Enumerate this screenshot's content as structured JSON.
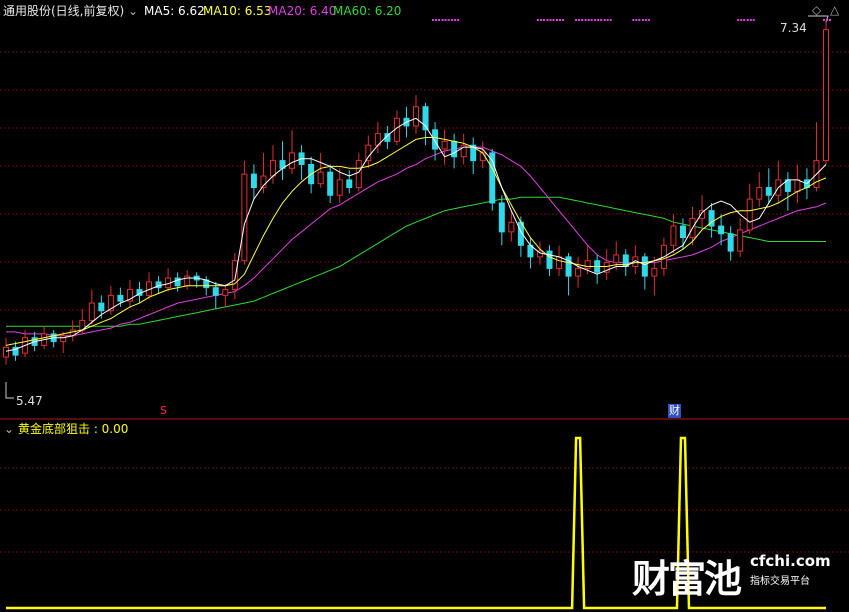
{
  "header": {
    "stock": "通用股份(日线,前复权)",
    "ma5": "MA5: 6.62",
    "ma10": "MA10: 6.53",
    "ma20": "MA20: 6.40",
    "ma60": "MA60: 6.20",
    "indicator": "黄金底部狙击 : 0.00"
  },
  "colors": {
    "up": "#e03030",
    "down": "#30d8e8",
    "ma5": "#ffffff",
    "ma10": "#ffff40",
    "ma20": "#e040e0",
    "ma60": "#30d830",
    "signal": "#ffff00",
    "border": "#b01818"
  },
  "markers": {
    "max_label": "7.34",
    "min_label": "5.47",
    "s_label": "S",
    "cai_label": "财"
  },
  "logo": {
    "cn": "财富池",
    "en": "cfchi.com",
    "sub": "指标交易平台"
  },
  "chart_data": {
    "type": "candlestick",
    "price_range": [
      5.47,
      7.34
    ],
    "ma5": [
      5.63,
      5.64,
      5.66,
      5.68,
      5.69,
      5.7,
      5.7,
      5.71,
      5.74,
      5.78,
      5.82,
      5.85,
      5.88,
      5.9,
      5.93,
      5.95,
      5.97,
      5.98,
      6.0,
      6.01,
      6.01,
      6.0,
      5.98,
      5.97,
      6.0,
      6.29,
      6.42,
      6.49,
      6.54,
      6.58,
      6.61,
      6.63,
      6.63,
      6.61,
      6.59,
      6.56,
      6.54,
      6.56,
      6.64,
      6.7,
      6.75,
      6.79,
      6.82,
      6.84,
      6.8,
      6.72,
      6.64,
      6.66,
      6.69,
      6.69,
      6.68,
      6.62,
      6.48,
      6.36,
      6.25,
      6.18,
      6.14,
      6.13,
      6.12,
      6.1,
      6.07,
      6.05,
      6.03,
      6.05,
      6.07,
      6.07,
      6.1,
      6.08,
      6.1,
      6.12,
      6.15,
      6.18,
      6.27,
      6.35,
      6.39,
      6.41,
      6.39,
      6.34,
      6.3,
      6.32,
      6.4,
      6.48,
      6.52,
      6.52,
      6.5,
      6.55,
      6.6
    ],
    "ma10": [
      5.66,
      5.67,
      5.68,
      5.69,
      5.7,
      5.71,
      5.72,
      5.73,
      5.74,
      5.76,
      5.78,
      5.8,
      5.83,
      5.86,
      5.88,
      5.91,
      5.93,
      5.95,
      5.96,
      5.97,
      5.97,
      5.97,
      5.97,
      5.97,
      5.98,
      6.03,
      6.13,
      6.23,
      6.32,
      6.4,
      6.46,
      6.51,
      6.55,
      6.58,
      6.59,
      6.59,
      6.58,
      6.58,
      6.59,
      6.61,
      6.64,
      6.67,
      6.7,
      6.73,
      6.74,
      6.74,
      6.73,
      6.72,
      6.71,
      6.69,
      6.66,
      6.58,
      6.48,
      6.39,
      6.3,
      6.22,
      6.16,
      6.12,
      6.1,
      6.09,
      6.08,
      6.07,
      6.07,
      6.07,
      6.08,
      6.08,
      6.09,
      6.09,
      6.1,
      6.11,
      6.13,
      6.16,
      6.2,
      6.26,
      6.3,
      6.33,
      6.35,
      6.36,
      6.36,
      6.37,
      6.38,
      6.4,
      6.43,
      6.46,
      6.48,
      6.51,
      6.53
    ],
    "ma20": [
      5.73,
      5.73,
      5.72,
      5.72,
      5.72,
      5.71,
      5.71,
      5.71,
      5.72,
      5.73,
      5.74,
      5.75,
      5.77,
      5.78,
      5.8,
      5.82,
      5.84,
      5.86,
      5.88,
      5.89,
      5.9,
      5.91,
      5.92,
      5.93,
      5.94,
      5.97,
      6.01,
      6.06,
      6.11,
      6.16,
      6.21,
      6.25,
      6.29,
      6.33,
      6.37,
      6.39,
      6.42,
      6.45,
      6.48,
      6.51,
      6.53,
      6.55,
      6.58,
      6.6,
      6.63,
      6.65,
      6.67,
      6.68,
      6.69,
      6.69,
      6.69,
      6.67,
      6.65,
      6.62,
      6.59,
      6.54,
      6.48,
      6.42,
      6.36,
      6.3,
      6.24,
      6.18,
      6.13,
      6.1,
      6.09,
      6.09,
      6.09,
      6.09,
      6.09,
      6.1,
      6.11,
      6.12,
      6.13,
      6.15,
      6.17,
      6.2,
      6.22,
      6.24,
      6.26,
      6.28,
      6.3,
      6.32,
      6.34,
      6.36,
      6.37,
      6.38,
      6.4
    ],
    "ma60": [
      5.76,
      5.76,
      5.76,
      5.76,
      5.76,
      5.76,
      5.76,
      5.76,
      5.76,
      5.76,
      5.76,
      5.76,
      5.76,
      5.77,
      5.77,
      5.78,
      5.79,
      5.8,
      5.81,
      5.82,
      5.83,
      5.84,
      5.85,
      5.86,
      5.87,
      5.88,
      5.89,
      5.91,
      5.93,
      5.95,
      5.97,
      5.99,
      6.01,
      6.03,
      6.05,
      6.07,
      6.1,
      6.13,
      6.16,
      6.19,
      6.22,
      6.25,
      6.28,
      6.3,
      6.32,
      6.34,
      6.36,
      6.37,
      6.38,
      6.39,
      6.4,
      6.41,
      6.42,
      6.42,
      6.43,
      6.43,
      6.43,
      6.43,
      6.43,
      6.42,
      6.41,
      6.4,
      6.39,
      6.38,
      6.37,
      6.36,
      6.35,
      6.34,
      6.33,
      6.32,
      6.3,
      6.29,
      6.28,
      6.27,
      6.26,
      6.25,
      6.24,
      6.23,
      6.22,
      6.21,
      6.2,
      6.2,
      6.2,
      6.2,
      6.2,
      6.2,
      6.2
    ],
    "candles": [
      {
        "o": 5.6,
        "c": 5.65,
        "h": 5.7,
        "l": 5.56
      },
      {
        "o": 5.65,
        "c": 5.61,
        "h": 5.68,
        "l": 5.58
      },
      {
        "o": 5.62,
        "c": 5.7,
        "h": 5.74,
        "l": 5.6
      },
      {
        "o": 5.7,
        "c": 5.66,
        "h": 5.73,
        "l": 5.63
      },
      {
        "o": 5.66,
        "c": 5.72,
        "h": 5.76,
        "l": 5.64
      },
      {
        "o": 5.72,
        "c": 5.68,
        "h": 5.74,
        "l": 5.65
      },
      {
        "o": 5.68,
        "c": 5.71,
        "h": 5.73,
        "l": 5.62
      },
      {
        "o": 5.71,
        "c": 5.74,
        "h": 5.79,
        "l": 5.68
      },
      {
        "o": 5.74,
        "c": 5.79,
        "h": 5.85,
        "l": 5.72
      },
      {
        "o": 5.79,
        "c": 5.88,
        "h": 5.95,
        "l": 5.77
      },
      {
        "o": 5.88,
        "c": 5.84,
        "h": 5.92,
        "l": 5.8
      },
      {
        "o": 5.84,
        "c": 5.92,
        "h": 5.97,
        "l": 5.82
      },
      {
        "o": 5.92,
        "c": 5.89,
        "h": 5.96,
        "l": 5.86
      },
      {
        "o": 5.89,
        "c": 5.95,
        "h": 6.0,
        "l": 5.86
      },
      {
        "o": 5.95,
        "c": 5.92,
        "h": 5.99,
        "l": 5.88
      },
      {
        "o": 5.92,
        "c": 5.99,
        "h": 6.04,
        "l": 5.9
      },
      {
        "o": 5.99,
        "c": 5.96,
        "h": 6.02,
        "l": 5.93
      },
      {
        "o": 5.96,
        "c": 6.01,
        "h": 6.06,
        "l": 5.94
      },
      {
        "o": 6.01,
        "c": 5.97,
        "h": 6.04,
        "l": 5.94
      },
      {
        "o": 5.97,
        "c": 6.02,
        "h": 6.05,
        "l": 5.95
      },
      {
        "o": 6.02,
        "c": 6.0,
        "h": 6.04,
        "l": 5.96
      },
      {
        "o": 6.0,
        "c": 5.96,
        "h": 6.02,
        "l": 5.92
      },
      {
        "o": 5.96,
        "c": 5.92,
        "h": 5.99,
        "l": 5.85
      },
      {
        "o": 5.92,
        "c": 5.95,
        "h": 5.98,
        "l": 5.86
      },
      {
        "o": 5.95,
        "c": 6.1,
        "h": 6.14,
        "l": 5.9
      },
      {
        "o": 6.1,
        "c": 6.55,
        "h": 6.62,
        "l": 6.08
      },
      {
        "o": 6.55,
        "c": 6.48,
        "h": 6.6,
        "l": 6.42
      },
      {
        "o": 6.48,
        "c": 6.54,
        "h": 6.66,
        "l": 6.45
      },
      {
        "o": 6.54,
        "c": 6.62,
        "h": 6.7,
        "l": 6.5
      },
      {
        "o": 6.62,
        "c": 6.58,
        "h": 6.72,
        "l": 6.52
      },
      {
        "o": 6.58,
        "c": 6.66,
        "h": 6.78,
        "l": 6.55
      },
      {
        "o": 6.66,
        "c": 6.6,
        "h": 6.7,
        "l": 6.52
      },
      {
        "o": 6.6,
        "c": 6.5,
        "h": 6.64,
        "l": 6.45
      },
      {
        "o": 6.5,
        "c": 6.56,
        "h": 6.66,
        "l": 6.48
      },
      {
        "o": 6.56,
        "c": 6.44,
        "h": 6.6,
        "l": 6.4
      },
      {
        "o": 6.44,
        "c": 6.52,
        "h": 6.58,
        "l": 6.4
      },
      {
        "o": 6.52,
        "c": 6.48,
        "h": 6.57,
        "l": 6.45
      },
      {
        "o": 6.48,
        "c": 6.62,
        "h": 6.66,
        "l": 6.46
      },
      {
        "o": 6.62,
        "c": 6.7,
        "h": 6.75,
        "l": 6.58
      },
      {
        "o": 6.7,
        "c": 6.76,
        "h": 6.82,
        "l": 6.66
      },
      {
        "o": 6.76,
        "c": 6.72,
        "h": 6.8,
        "l": 6.68
      },
      {
        "o": 6.72,
        "c": 6.84,
        "h": 6.88,
        "l": 6.7
      },
      {
        "o": 6.84,
        "c": 6.8,
        "h": 6.9,
        "l": 6.74
      },
      {
        "o": 6.8,
        "c": 6.9,
        "h": 6.96,
        "l": 6.76
      },
      {
        "o": 6.9,
        "c": 6.78,
        "h": 6.92,
        "l": 6.7
      },
      {
        "o": 6.78,
        "c": 6.68,
        "h": 6.82,
        "l": 6.62
      },
      {
        "o": 6.68,
        "c": 6.72,
        "h": 6.78,
        "l": 6.6
      },
      {
        "o": 6.72,
        "c": 6.64,
        "h": 6.76,
        "l": 6.58
      },
      {
        "o": 6.64,
        "c": 6.7,
        "h": 6.76,
        "l": 6.6
      },
      {
        "o": 6.7,
        "c": 6.62,
        "h": 6.74,
        "l": 6.55
      },
      {
        "o": 6.62,
        "c": 6.66,
        "h": 6.72,
        "l": 6.58
      },
      {
        "o": 6.66,
        "c": 6.4,
        "h": 6.68,
        "l": 6.36
      },
      {
        "o": 6.4,
        "c": 6.25,
        "h": 6.44,
        "l": 6.18
      },
      {
        "o": 6.25,
        "c": 6.3,
        "h": 6.36,
        "l": 6.2
      },
      {
        "o": 6.3,
        "c": 6.18,
        "h": 6.33,
        "l": 6.12
      },
      {
        "o": 6.18,
        "c": 6.12,
        "h": 6.22,
        "l": 6.06
      },
      {
        "o": 6.12,
        "c": 6.15,
        "h": 6.2,
        "l": 6.08
      },
      {
        "o": 6.15,
        "c": 6.06,
        "h": 6.18,
        "l": 6.02
      },
      {
        "o": 6.06,
        "c": 6.12,
        "h": 6.18,
        "l": 6.02
      },
      {
        "o": 6.12,
        "c": 6.02,
        "h": 6.14,
        "l": 5.92
      },
      {
        "o": 6.02,
        "c": 6.06,
        "h": 6.12,
        "l": 5.96
      },
      {
        "o": 6.06,
        "c": 6.1,
        "h": 6.18,
        "l": 6.03
      },
      {
        "o": 6.1,
        "c": 6.04,
        "h": 6.13,
        "l": 5.98
      },
      {
        "o": 6.04,
        "c": 6.09,
        "h": 6.16,
        "l": 6.0
      },
      {
        "o": 6.09,
        "c": 6.13,
        "h": 6.2,
        "l": 6.05
      },
      {
        "o": 6.13,
        "c": 6.07,
        "h": 6.16,
        "l": 6.02
      },
      {
        "o": 6.07,
        "c": 6.12,
        "h": 6.18,
        "l": 6.03
      },
      {
        "o": 6.12,
        "c": 6.02,
        "h": 6.14,
        "l": 5.95
      },
      {
        "o": 6.02,
        "c": 6.06,
        "h": 6.12,
        "l": 5.92
      },
      {
        "o": 6.06,
        "c": 6.18,
        "h": 6.22,
        "l": 6.02
      },
      {
        "o": 6.18,
        "c": 6.28,
        "h": 6.34,
        "l": 6.14
      },
      {
        "o": 6.28,
        "c": 6.22,
        "h": 6.32,
        "l": 6.16
      },
      {
        "o": 6.22,
        "c": 6.32,
        "h": 6.38,
        "l": 6.18
      },
      {
        "o": 6.32,
        "c": 6.36,
        "h": 6.44,
        "l": 6.26
      },
      {
        "o": 6.36,
        "c": 6.28,
        "h": 6.4,
        "l": 6.22
      },
      {
        "o": 6.28,
        "c": 6.24,
        "h": 6.34,
        "l": 6.18
      },
      {
        "o": 6.24,
        "c": 6.15,
        "h": 6.28,
        "l": 6.1
      },
      {
        "o": 6.15,
        "c": 6.26,
        "h": 6.32,
        "l": 6.12
      },
      {
        "o": 6.26,
        "c": 6.42,
        "h": 6.5,
        "l": 6.24
      },
      {
        "o": 6.42,
        "c": 6.48,
        "h": 6.56,
        "l": 6.38
      },
      {
        "o": 6.48,
        "c": 6.44,
        "h": 6.58,
        "l": 6.4
      },
      {
        "o": 6.44,
        "c": 6.52,
        "h": 6.62,
        "l": 6.4
      },
      {
        "o": 6.52,
        "c": 6.46,
        "h": 6.56,
        "l": 6.36
      },
      {
        "o": 6.46,
        "c": 6.52,
        "h": 6.6,
        "l": 6.4
      },
      {
        "o": 6.52,
        "c": 6.48,
        "h": 6.58,
        "l": 6.42
      },
      {
        "o": 6.48,
        "c": 6.62,
        "h": 6.82,
        "l": 6.46
      },
      {
        "o": 6.62,
        "c": 7.3,
        "h": 7.34,
        "l": 6.6
      }
    ],
    "signal": [
      0,
      0,
      0,
      0,
      0,
      0,
      0,
      0,
      0,
      0,
      0,
      0,
      0,
      0,
      0,
      0,
      0,
      0,
      0,
      0,
      0,
      0,
      0,
      0,
      0,
      0,
      0,
      0,
      0,
      0,
      0,
      0,
      0,
      0,
      0,
      0,
      0,
      0,
      0,
      0,
      0,
      0,
      0,
      0,
      0,
      0,
      0,
      0,
      0,
      0,
      0,
      0,
      0,
      0,
      0,
      0,
      0,
      0,
      0,
      0,
      1,
      0,
      0,
      0,
      0,
      0,
      0,
      0,
      0,
      0,
      0,
      1,
      0,
      0,
      0,
      0,
      0,
      0,
      0,
      0,
      0,
      0,
      0,
      0,
      0,
      0,
      0
    ],
    "top_dots": [
      45,
      46,
      47,
      56,
      57,
      58,
      60,
      61,
      62,
      63,
      66,
      67,
      77,
      78,
      86
    ]
  }
}
